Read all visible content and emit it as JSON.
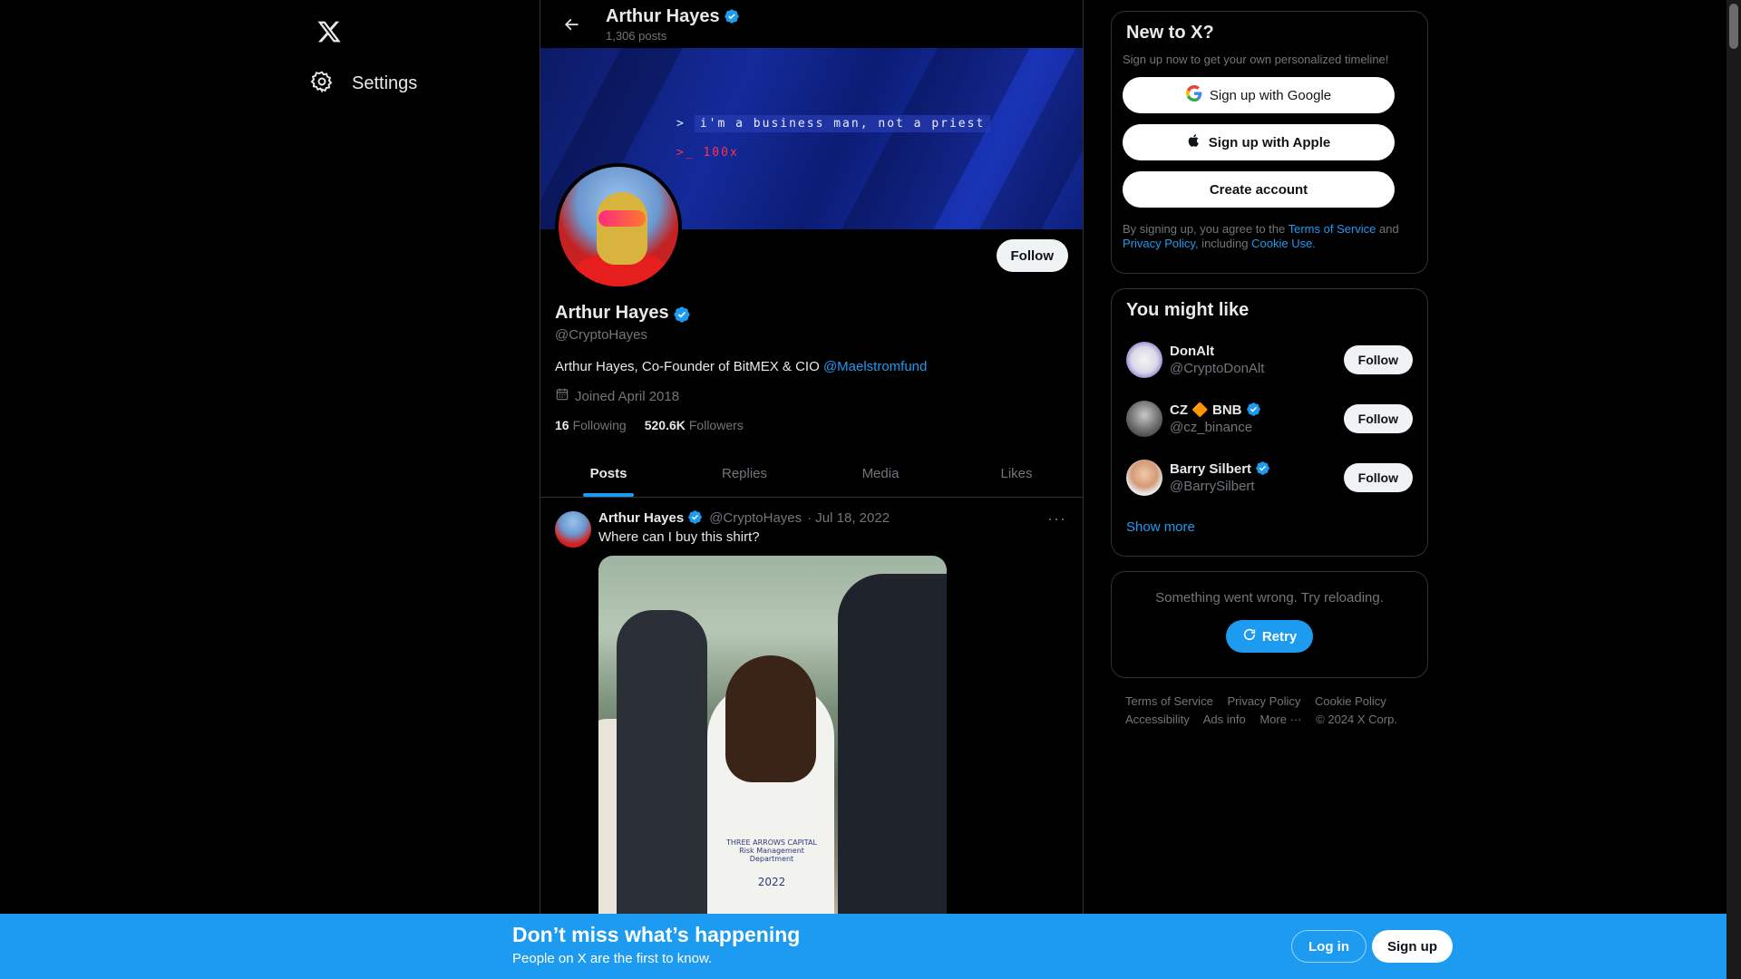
{
  "nav": {
    "settings_label": "Settings"
  },
  "header": {
    "name": "Arthur Hayes",
    "posts_count": "1,306 posts"
  },
  "banner": {
    "line1_prompt": ">",
    "line1_text": "i'm a business man, not a priest",
    "line2_text": ">_  100x"
  },
  "profile": {
    "follow_label": "Follow",
    "name": "Arthur Hayes",
    "handle": "@CryptoHayes",
    "bio_text": "Arthur Hayes, Co-Founder of BitMEX & CIO ",
    "bio_link": "@Maelstromfund",
    "joined": "Joined April 2018",
    "following_count": "16",
    "following_label": "Following",
    "followers_count": "520.6K",
    "followers_label": "Followers"
  },
  "tabs": [
    {
      "label": "Posts"
    },
    {
      "label": "Replies"
    },
    {
      "label": "Media"
    },
    {
      "label": "Likes"
    }
  ],
  "tweet": {
    "name": "Arthur Hayes",
    "handle": "@CryptoHayes",
    "date": "· Jul 18, 2022",
    "text": "Where can I buy this shirt?",
    "more_icon": "···",
    "shirt_line1": "THREE ARROWS CAPITAL",
    "shirt_line2": "Risk Management Department",
    "shirt_year": "2022"
  },
  "new_to_x": {
    "title": "New to X?",
    "subtitle": "Sign up now to get your own personalized timeline!",
    "google_label": "Sign up with Google",
    "apple_label": "Sign up with Apple",
    "create_label": "Create account",
    "legal_prefix": "By signing up, you agree to the ",
    "terms": "Terms of Service",
    "and": " and ",
    "privacy": "Privacy Policy",
    "including": ", including ",
    "cookie": "Cookie Use."
  },
  "you_might_like": {
    "title": "You might like",
    "people": [
      {
        "name": "DonAlt",
        "handle": "@CryptoDonAlt",
        "follow": "Follow"
      },
      {
        "name": "CZ 🔶 BNB",
        "handle": "@cz_binance",
        "follow": "Follow"
      },
      {
        "name": "Barry Silbert",
        "handle": "@BarrySilbert",
        "follow": "Follow"
      }
    ],
    "show_more": "Show more"
  },
  "error_card": {
    "message": "Something went wrong. Try reloading.",
    "retry": "Retry"
  },
  "footer": {
    "links_row1": [
      "Terms of Service",
      "Privacy Policy",
      "Cookie Policy"
    ],
    "links_row2": [
      "Accessibility",
      "Ads info",
      "More ···",
      "© 2024 X Corp."
    ]
  },
  "bottom_bar": {
    "title": "Don’t miss what’s happening",
    "subtitle": "People on X are the first to know.",
    "login": "Log in",
    "signup": "Sign up"
  },
  "colors": {
    "accent": "#1d9bf0",
    "background": "#000000",
    "muted": "#71767b"
  }
}
